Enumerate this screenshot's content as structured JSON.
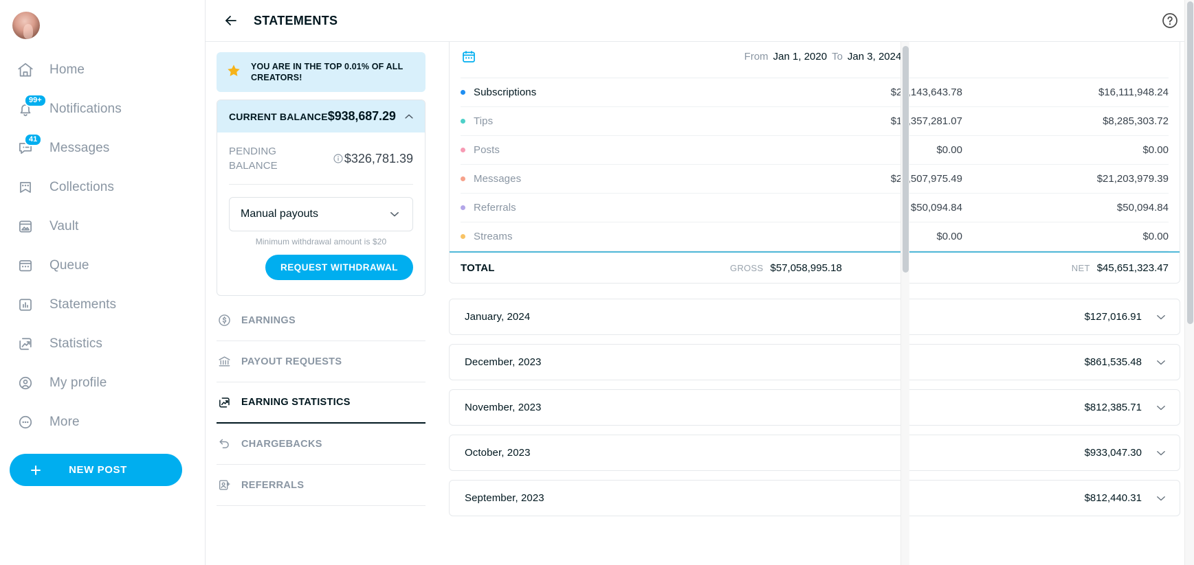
{
  "sidebar": {
    "avatar_name": "user-avatar",
    "items": [
      {
        "label": "Home",
        "icon": "home-icon",
        "badge": null
      },
      {
        "label": "Notifications",
        "icon": "bell-icon",
        "badge": "99+"
      },
      {
        "label": "Messages",
        "icon": "chat-icon",
        "badge": "41"
      },
      {
        "label": "Collections",
        "icon": "bookmark-stars-icon",
        "badge": null
      },
      {
        "label": "Vault",
        "icon": "image-box-icon",
        "badge": null
      },
      {
        "label": "Queue",
        "icon": "calendar-icon",
        "badge": null
      },
      {
        "label": "Statements",
        "icon": "bar-chart-icon",
        "badge": null
      },
      {
        "label": "Statistics",
        "icon": "trend-up-icon",
        "badge": null
      },
      {
        "label": "My profile",
        "icon": "user-circle-icon",
        "badge": null
      },
      {
        "label": "More",
        "icon": "ellipsis-circle-icon",
        "badge": null
      }
    ],
    "new_post_label": "NEW POST",
    "new_post_icon": "plus-icon"
  },
  "header": {
    "back_icon": "arrow-left-icon",
    "title": "STATEMENTS",
    "help_icon": "help-circle-icon"
  },
  "promo": {
    "icon": "star-icon",
    "text": "YOU ARE IN THE TOP 0.01% OF ALL CREATORS!"
  },
  "balance": {
    "label": "CURRENT BALANCE",
    "value": "$938,687.29",
    "collapse_icon": "chevron-up-icon",
    "pending_label": "PENDING BALANCE",
    "pending_info_icon": "info-icon",
    "pending_value": "$326,781.39",
    "payout_mode": "Manual payouts",
    "payout_chevron_icon": "chevron-down-icon",
    "min_note": "Minimum withdrawal amount is $20",
    "withdraw_label": "REQUEST WITHDRAWAL"
  },
  "tabs": [
    {
      "label": "EARNINGS",
      "icon": "dollar-circle-icon",
      "active": false
    },
    {
      "label": "PAYOUT REQUESTS",
      "icon": "bank-icon",
      "active": false
    },
    {
      "label": "EARNING STATISTICS",
      "icon": "chart-box-icon",
      "active": true
    },
    {
      "label": "CHARGEBACKS",
      "icon": "undo-arrow-icon",
      "active": false
    },
    {
      "label": "REFERRALS",
      "icon": "user-add-icon",
      "active": false
    }
  ],
  "date_range": {
    "calendar_icon": "calendar-icon",
    "from_label": "From",
    "from_value": "Jan 1, 2020",
    "to_label": "To",
    "to_value": "Jan 3, 2024"
  },
  "earnings_table": {
    "rows": [
      {
        "name": "Subscriptions",
        "gross": "$20,143,643.78",
        "net": "$16,111,948.24",
        "color": "#1f8ef1"
      },
      {
        "name": "Tips",
        "gross": "$10,357,281.07",
        "net": "$8,285,303.72",
        "color": "#4dd0c8"
      },
      {
        "name": "Posts",
        "gross": "$0.00",
        "net": "$0.00",
        "color": "#f79bb4"
      },
      {
        "name": "Messages",
        "gross": "$26,507,975.49",
        "net": "$21,203,979.39",
        "color": "#f6a28b"
      },
      {
        "name": "Referrals",
        "gross": "$50,094.84",
        "net": "$50,094.84",
        "color": "#b3a6e8"
      },
      {
        "name": "Streams",
        "gross": "$0.00",
        "net": "$0.00",
        "color": "#f8c365"
      }
    ],
    "total_label": "TOTAL",
    "gross_caption": "GROSS",
    "gross_total": "$57,058,995.18",
    "net_caption": "NET",
    "net_total": "$45,651,323.47"
  },
  "months": [
    {
      "name": "January, 2024",
      "amount": "$127,016.91",
      "icon": "chevron-down-icon"
    },
    {
      "name": "December, 2023",
      "amount": "$861,535.48",
      "icon": "chevron-down-icon"
    },
    {
      "name": "November, 2023",
      "amount": "$812,385.71",
      "icon": "chevron-down-icon"
    },
    {
      "name": "October, 2023",
      "amount": "$933,047.30",
      "icon": "chevron-down-icon"
    },
    {
      "name": "September, 2023",
      "amount": "$812,440.31",
      "icon": "chevron-down-icon"
    }
  ],
  "colors": {
    "accent": "#00aeef",
    "promo_bg": "#d9f0fb",
    "star": "#f6b319",
    "total_rule": "#4fb8d8"
  }
}
